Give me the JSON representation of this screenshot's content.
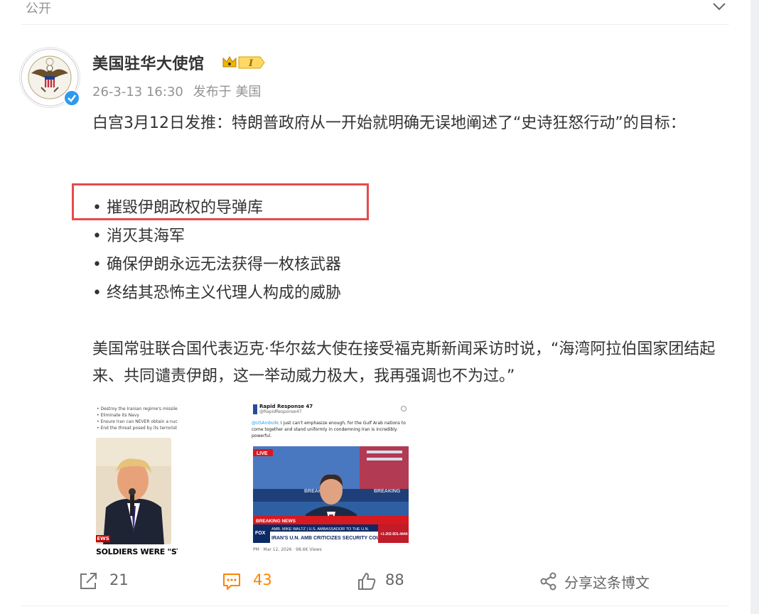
{
  "header": {
    "visibility_label": "公开",
    "toggle_icon": "chevron-down-icon"
  },
  "post": {
    "author": {
      "name": "美国驻华大使馆",
      "verified": true,
      "verified_color": "#2d9aef",
      "member_badge_text": "I"
    },
    "meta": {
      "time": "26-3-13 16:30",
      "location": "发布于 美国"
    },
    "paragraph1": "白宫3月12日发推：特朗普政府从一开始就明确无误地阐述了“史诗狂怒行动”的目标：",
    "bullets": [
      "• 摧毁伊朗政权的导弹库",
      "• 消灭其海军",
      "• 确保伊朗永远无法获得一枚核武器",
      "• 终结其恐怖主义代理人构成的威胁"
    ],
    "highlight_color": "#e84a4a",
    "paragraph2": "美国常驻联合国代表迈克·华尔兹大使在接受福克斯新闻采访时说，“海湾阿拉伯国家团结起来、共同谴责伊朗，这一举动威力极大，我再强调也不为过。”",
    "images": [
      {
        "text_lines": [
          "• Destroy the Iranian regime's missile arsenal",
          "• Eliminate its Navy",
          "• Ensure Iran can NEVER obtain a nuclear weapon",
          "• End the threat posed by its terrorist proxies"
        ],
        "news_tag": "EWS",
        "caption": "SOLDIERS WERE \"STEADF"
      },
      {
        "account_name": "Rapid Response 47",
        "account_handle": "@RapidResponse47",
        "tweet_mention": "@USAmbUN",
        "tweet_text": ": I just can't emphasize enough, for the Gulf Arab nations to come together and stand uniformly in condemning Iran is incredibly powerful.",
        "live_tag": "LIVE",
        "breaking_label": "BREAKING",
        "lower_third_top": "AMB. MIKE WALTZ | U.S. AMBASSADOR TO THE U.N.",
        "lower_third_main": "IRAN'S U.N. AMB CRITICIZES SECURITY COUNCIL VOTE",
        "footer": "PM · Mar 12, 2026 · 98.6K Views"
      }
    ]
  },
  "actions": {
    "repost_count": "21",
    "comment_count": "43",
    "like_count": "88",
    "share_label": "分享这条博文",
    "comment_color": "#ff8200"
  }
}
